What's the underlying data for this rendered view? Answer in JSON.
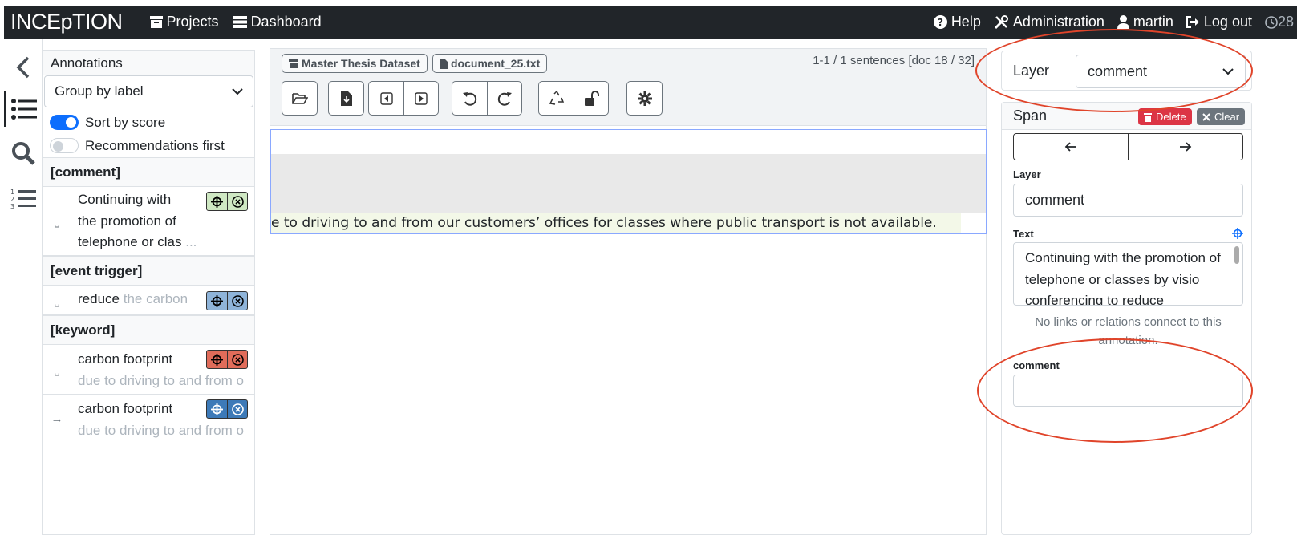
{
  "navbar": {
    "brand": "INCEpTION",
    "projects": "Projects",
    "dashboard": "Dashboard",
    "help": "Help",
    "administration": "Administration",
    "user": "martin",
    "logout": "Log out",
    "timer": "28 min"
  },
  "annotations_panel": {
    "title": "Annotations",
    "group_by": "Group by label",
    "sort_by_score": "Sort by score",
    "recommendations_first": "Recommendations first",
    "groups": [
      {
        "title": "[comment]",
        "items": [
          {
            "gutter": "⎵",
            "line1": "Continuing with",
            "line2": "the promotion of",
            "line3": "telephone or clas",
            "ellipsis": "...",
            "color": "#cfe8c3"
          }
        ]
      },
      {
        "title": "[event trigger]",
        "items": [
          {
            "gutter": "⎵",
            "text": "reduce",
            "muted": "the carbon",
            "color": "#8fb4d9"
          }
        ]
      },
      {
        "title": "[keyword]",
        "items": [
          {
            "gutter": "⎵",
            "text": "carbon footprint",
            "muted": "due to driving to and from o",
            "color": "#e06c5a"
          },
          {
            "gutter": "→",
            "text": "carbon footprint",
            "muted": "due to driving to and from o",
            "color": "#3d7ab8"
          }
        ]
      }
    ]
  },
  "editor": {
    "project_tag": "Master Thesis Dataset",
    "document_tag": "document_25.txt",
    "sentence_info": "1-1 / 1 sentences [doc 18 / 32]",
    "text_line": "e to driving to and from our customers’ offices for classes where public transport is not available."
  },
  "right_panel": {
    "layer_label": "Layer",
    "layer_value": "comment",
    "span_title": "Span",
    "delete_label": "Delete",
    "clear_label": "Clear",
    "field_layer_label": "Layer",
    "field_layer_value": "comment",
    "text_label": "Text",
    "text_value": "Continuing with the promotion of telephone or classes by visio conferencing to reduce",
    "no_links": "No links or relations connect to this annotation.",
    "comment_label": "comment",
    "comment_value": ""
  },
  "colors": {
    "navbar_bg": "#212529",
    "highlight_ring": "#e0442a",
    "delete_red": "#dc3545",
    "clear_gray": "#6c757d",
    "primary_blue": "#0d6efd"
  }
}
